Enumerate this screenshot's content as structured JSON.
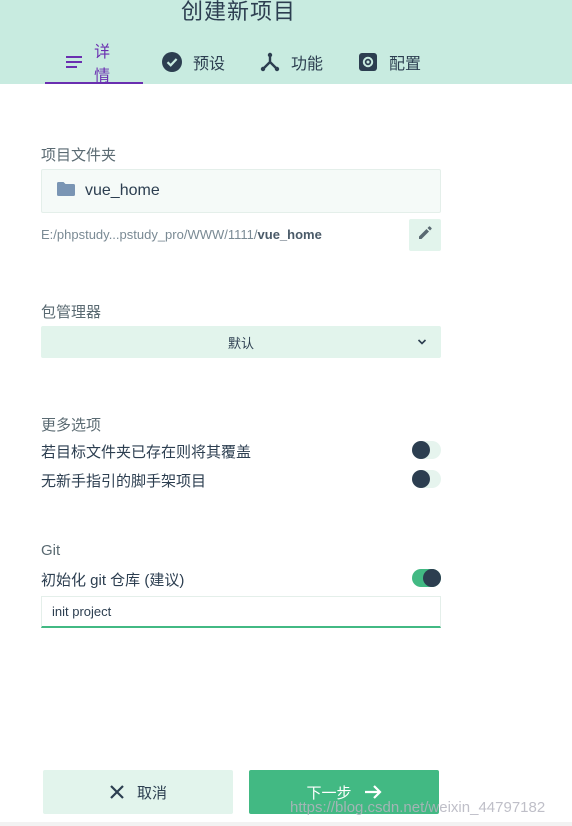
{
  "header": {
    "title": "创建新项目",
    "tabs": [
      {
        "label": "详情",
        "icon": "list-icon",
        "active": true
      },
      {
        "label": "预设",
        "icon": "check-circle-icon",
        "active": false
      },
      {
        "label": "功能",
        "icon": "merge-icon",
        "active": false
      },
      {
        "label": "配置",
        "icon": "settings-icon",
        "active": false
      }
    ]
  },
  "folder": {
    "label": "项目文件夹",
    "name": "vue_home",
    "path_prefix": "E:/phpstudy...pstudy_pro/WWW/1111/",
    "path_name": "vue_home"
  },
  "package_manager": {
    "label": "包管理器",
    "selected": "默认"
  },
  "more_options": {
    "label": "更多选项",
    "items": [
      {
        "label": "若目标文件夹已存在则将其覆盖",
        "enabled": false
      },
      {
        "label": "无新手指引的脚手架项目",
        "enabled": false
      }
    ]
  },
  "git": {
    "label": "Git",
    "init_label": "初始化 git 仓库 (建议)",
    "init_enabled": true,
    "commit_message": "init project"
  },
  "footer": {
    "cancel_label": "取消",
    "next_label": "下一步",
    "watermark": "https://blog.csdn.net/weixin_44797182"
  },
  "colors": {
    "accent": "#42b983",
    "active_tab": "#6a2fb0",
    "header_bg": "#c8ebe0",
    "text": "#2c3e50"
  }
}
